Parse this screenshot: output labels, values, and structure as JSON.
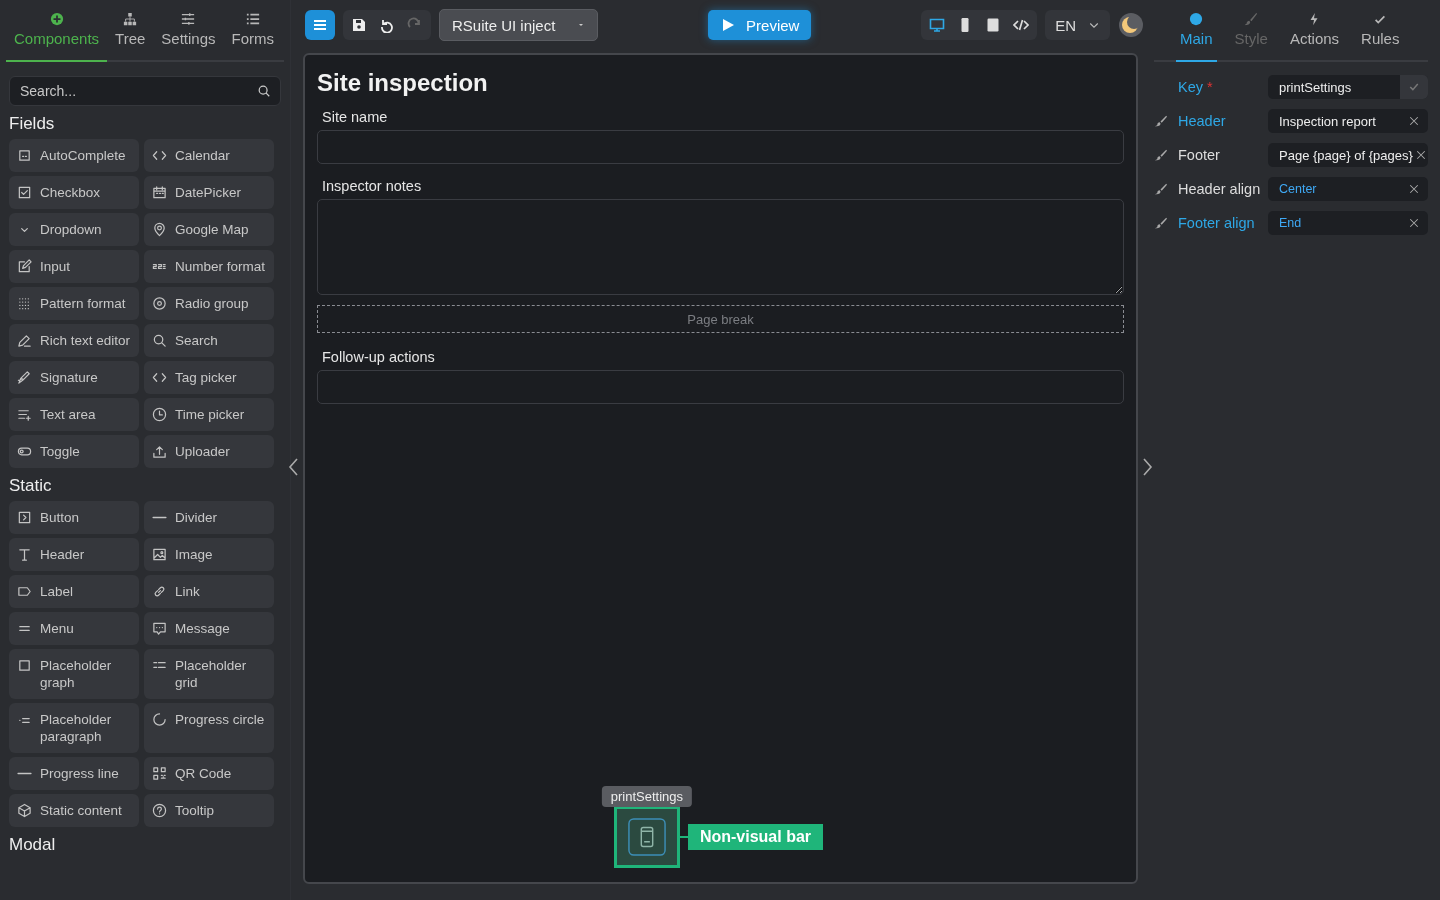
{
  "left_tabs": [
    {
      "label": "Components",
      "selected": true
    },
    {
      "label": "Tree",
      "selected": false
    },
    {
      "label": "Settings",
      "selected": false
    },
    {
      "label": "Forms",
      "selected": false
    }
  ],
  "search": {
    "placeholder": "Search..."
  },
  "sections": [
    {
      "title": "Fields",
      "items": [
        "AutoComplete",
        "Calendar",
        "Checkbox",
        "DatePicker",
        "Dropdown",
        "Google Map",
        "Input",
        "Number format",
        "Pattern format",
        "Radio group",
        "Rich text editor",
        "Search",
        "Signature",
        "Tag picker",
        "Text area",
        "Time picker",
        "Toggle",
        "Uploader"
      ]
    },
    {
      "title": "Static",
      "items": [
        "Button",
        "Divider",
        "Header",
        "Image",
        "Label",
        "Link",
        "Menu",
        "Message",
        "Placeholder graph",
        "Placeholder grid",
        "Placeholder paragraph",
        "Progress circle",
        "Progress line",
        "QR Code",
        "Static content",
        "Tooltip"
      ]
    },
    {
      "title": "Modal"
    }
  ],
  "toolbar": {
    "project": "RSuite UI inject",
    "preview": "Preview",
    "undo_disabled": false,
    "redo_disabled": true,
    "devices": [
      {
        "selected": true
      },
      {
        "selected": false
      },
      {
        "selected": false
      },
      {
        "selected": false
      }
    ],
    "language": "EN"
  },
  "form": {
    "title": "Site inspection",
    "fields": [
      {
        "kind": "input",
        "label": "Site name"
      },
      {
        "kind": "textarea",
        "label": "Inspector notes"
      },
      {
        "kind": "page_break",
        "label": "Page break"
      },
      {
        "kind": "input",
        "label": "Follow-up actions"
      }
    ]
  },
  "non_visual": {
    "tooltip": "printSettings",
    "label": "Non-visual bar",
    "selected": true
  },
  "right_tabs": [
    {
      "label": "Main",
      "selected": true,
      "disabled": false
    },
    {
      "label": "Style",
      "selected": false,
      "disabled": true
    },
    {
      "label": "Actions",
      "selected": false,
      "disabled": false
    },
    {
      "label": "Rules",
      "selected": false,
      "disabled": false
    }
  ],
  "properties": [
    {
      "kind": "key",
      "label": "Key",
      "required_mark": "*",
      "highlighted": true,
      "value": "printSettings"
    },
    {
      "kind": "text",
      "label": "Header",
      "highlighted": true,
      "value": "Inspection report"
    },
    {
      "kind": "text",
      "label": "Footer",
      "highlighted": false,
      "value": "Page {page} of {pages}"
    },
    {
      "kind": "select",
      "label": "Header align",
      "highlighted": false,
      "value": "Center"
    },
    {
      "kind": "select",
      "label": "Footer align",
      "highlighted": true,
      "value": "End"
    }
  ]
}
